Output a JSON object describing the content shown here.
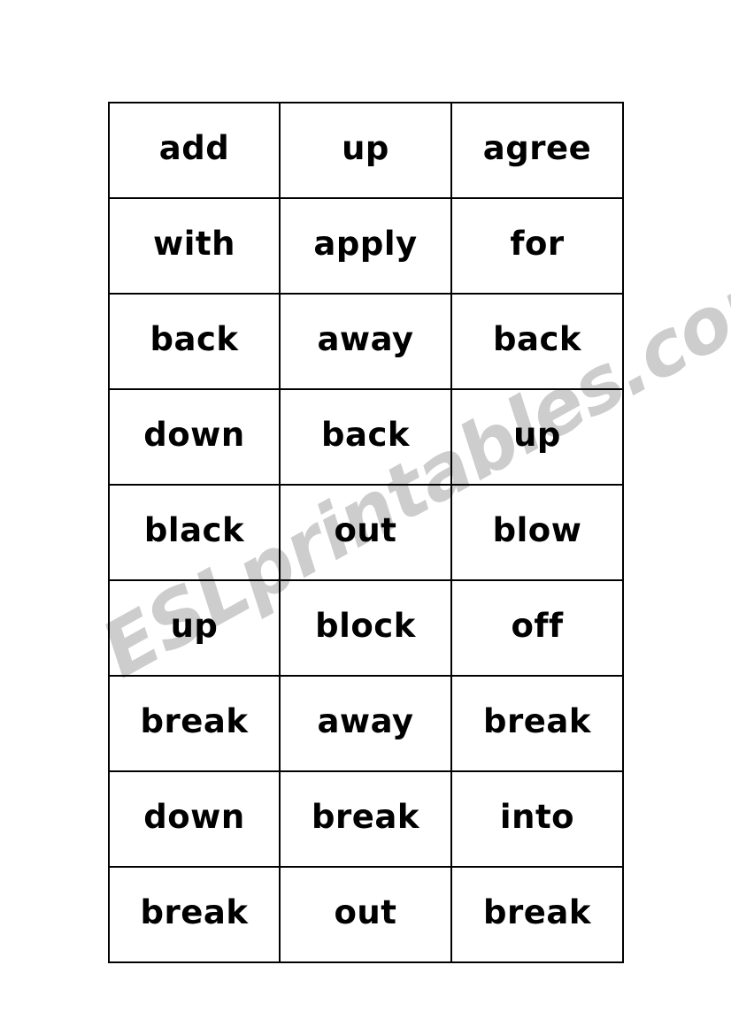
{
  "page": {
    "background_color": "#ffffff",
    "text_color": "#000000",
    "border_color": "#000000"
  },
  "watermark": {
    "text": "ESLprintables.com",
    "color": "#cdcdcd",
    "rotation_degrees": -29
  },
  "worksheet": {
    "type": "phrasal-verb-flashcard-grid",
    "columns": 3,
    "rows": 9,
    "cells": [
      [
        "add",
        "up",
        "agree"
      ],
      [
        "with",
        "apply",
        "for"
      ],
      [
        "back",
        "away",
        "back"
      ],
      [
        "down",
        "back",
        "up"
      ],
      [
        "black",
        "out",
        "blow"
      ],
      [
        "up",
        "block",
        "off"
      ],
      [
        "break",
        "away",
        "break"
      ],
      [
        "down",
        "break",
        "into"
      ],
      [
        "break",
        "out",
        "break"
      ]
    ]
  }
}
